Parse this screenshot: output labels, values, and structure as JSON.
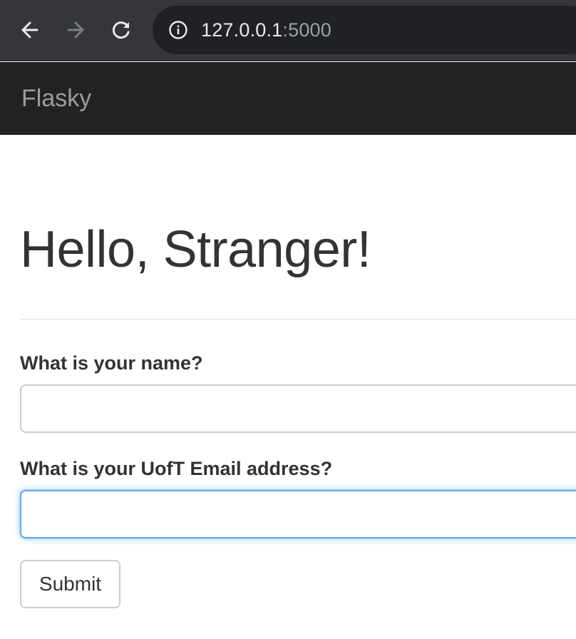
{
  "browser": {
    "url_host": "127.0.0.1",
    "url_port": ":5000",
    "icons": {
      "back": "arrow-left-icon",
      "forward": "arrow-right-icon",
      "reload": "reload-icon",
      "site_info": "info-circle-icon"
    },
    "forward_enabled": false
  },
  "navbar": {
    "brand": "Flasky"
  },
  "main": {
    "title": "Hello, Stranger!",
    "form": {
      "name_label": "What is your name?",
      "name_value": "",
      "email_label": "What is your UofT Email address?",
      "email_value": "",
      "email_focused": true,
      "submit_label": "Submit"
    }
  },
  "colors": {
    "browser_chrome": "#35363a",
    "omnibox": "#202124",
    "navbar": "#222222",
    "brand_text": "#9d9d9d",
    "text": "#333333",
    "focus_ring": "#66afe9"
  }
}
